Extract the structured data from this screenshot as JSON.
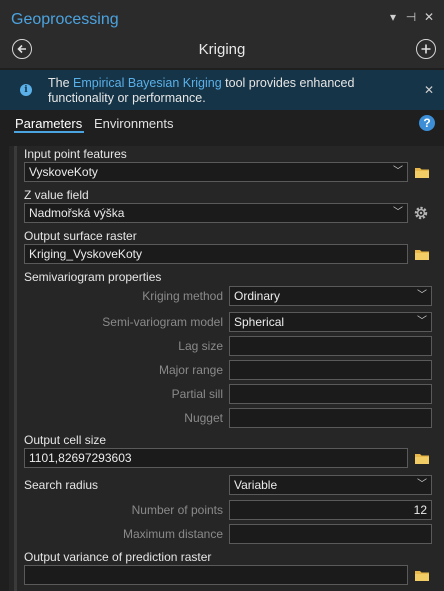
{
  "pane": {
    "title": "Geoprocessing",
    "controls": [
      "▾",
      "⊣",
      "✕"
    ]
  },
  "tool": {
    "title": "Kriging"
  },
  "info": {
    "prefix": "The ",
    "link": "Empirical Bayesian Kriging",
    "suffix": " tool provides enhanced functionality or performance."
  },
  "tabs": [
    {
      "label": "Parameters",
      "active": true
    },
    {
      "label": "Environments",
      "active": false
    }
  ],
  "params": {
    "input_point_features": {
      "label": "Input point features",
      "value": "VyskoveKoty"
    },
    "z_value_field": {
      "label": "Z value field",
      "value": "Nadmořská výška"
    },
    "output_surface_raster": {
      "label": "Output surface raster",
      "value": "Kriging_VyskoveKoty"
    },
    "semivariogram_properties": {
      "label": "Semivariogram properties"
    },
    "kriging_method": {
      "label": "Kriging method",
      "value": "Ordinary"
    },
    "semi_variogram_model": {
      "label": "Semi-variogram model",
      "value": "Spherical"
    },
    "lag_size": {
      "label": "Lag size",
      "value": ""
    },
    "major_range": {
      "label": "Major range",
      "value": ""
    },
    "partial_sill": {
      "label": "Partial sill",
      "value": ""
    },
    "nugget": {
      "label": "Nugget",
      "value": ""
    },
    "output_cell_size": {
      "label": "Output cell size",
      "value": "1101,82697293603"
    },
    "search_radius": {
      "label": "Search radius",
      "value": "Variable"
    },
    "number_of_points": {
      "label": "Number of points",
      "value": "12"
    },
    "maximum_distance": {
      "label": "Maximum distance",
      "value": ""
    },
    "output_variance_raster": {
      "label": "Output variance of prediction raster",
      "value": ""
    }
  },
  "colors": {
    "accent": "#4ba3e0",
    "folder": "#e8b84a",
    "info_bg": "#163447"
  },
  "icons": {
    "back": "arrow-left-circle-icon",
    "add": "plus-circle-icon",
    "info": "info-icon",
    "help": "help-icon",
    "folder": "folder-icon",
    "gear": "gear-icon"
  }
}
